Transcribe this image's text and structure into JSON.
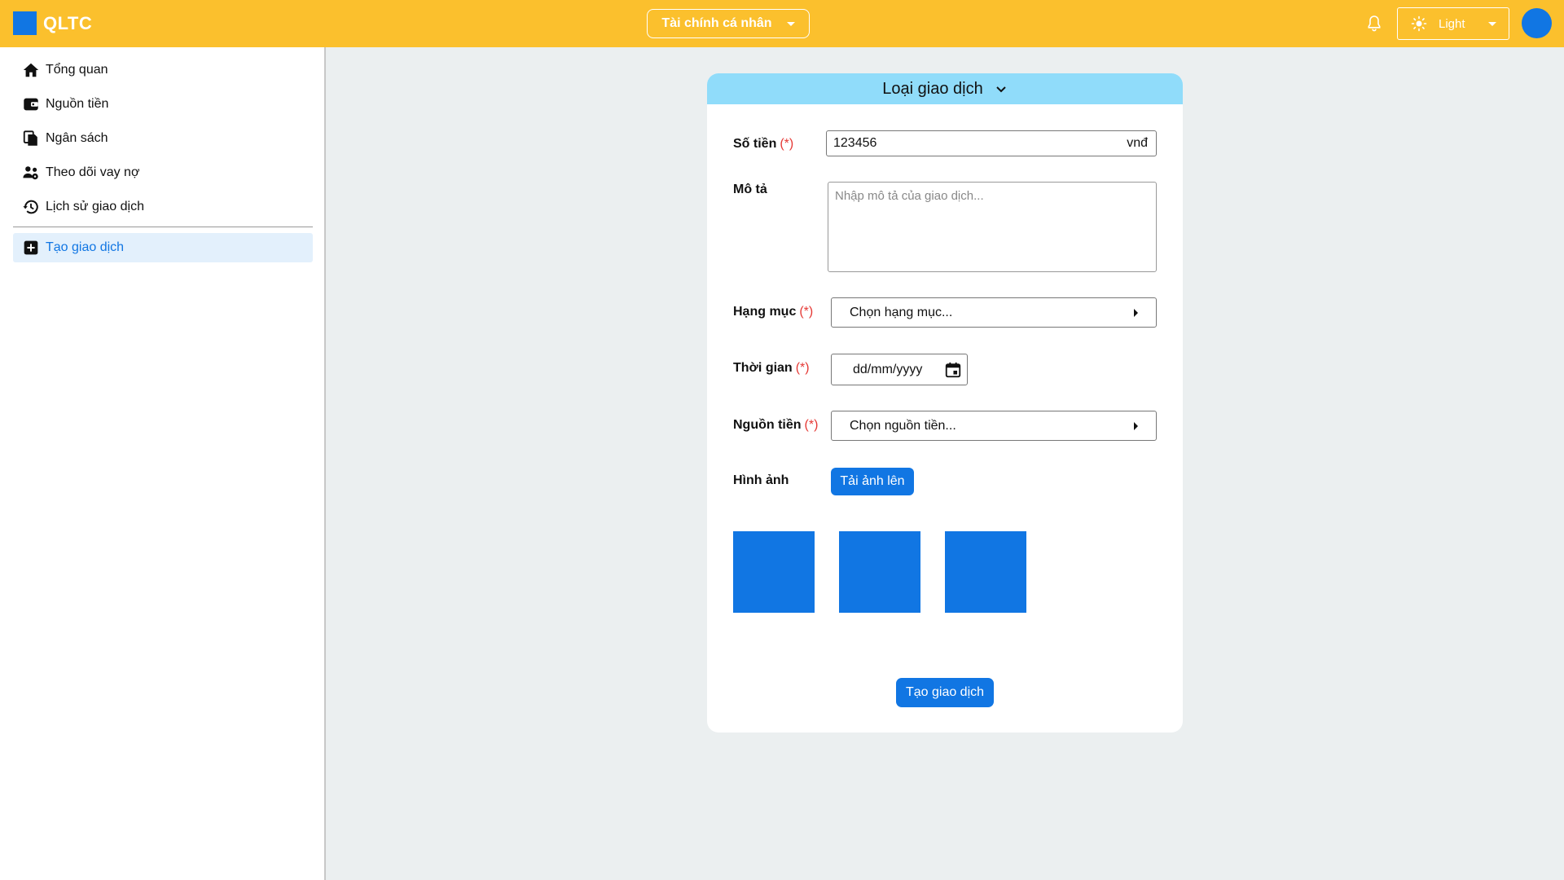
{
  "app": {
    "logo_text": "QLTC"
  },
  "header": {
    "context": "Tài chính cá nhân",
    "theme": "Light"
  },
  "sidebar": {
    "items": [
      {
        "label": "Tổng quan",
        "icon": "home-icon"
      },
      {
        "label": "Nguồn tiền",
        "icon": "wallet-icon"
      },
      {
        "label": "Ngân sách",
        "icon": "budget-icon"
      },
      {
        "label": "Theo dõi vay nợ",
        "icon": "people-icon"
      },
      {
        "label": "Lịch sử giao dịch",
        "icon": "history-icon"
      }
    ],
    "active_item": {
      "label": "Tạo giao dịch",
      "icon": "add-box-icon"
    }
  },
  "form": {
    "title": "Loại giao dịch",
    "required_mark": "(*)",
    "amount": {
      "label": "Số tiền",
      "value": "123456",
      "unit": "vnđ"
    },
    "description": {
      "label": "Mô tả",
      "placeholder": "Nhập mô tả của giao dịch..."
    },
    "category": {
      "label": "Hạng mục",
      "value": "Chọn hạng mục..."
    },
    "time": {
      "label": "Thời gian",
      "value": "dd/mm/yyyy"
    },
    "source": {
      "label": "Nguồn tiền",
      "value": "Chọn nguồn tiền..."
    },
    "image": {
      "label": "Hình ảnh",
      "upload_label": "Tải ảnh lên",
      "thumbnail_count": 3
    },
    "submit_label": "Tạo giao dịch"
  },
  "colors": {
    "header_bg": "#fbc02d",
    "primary": "#1176e3",
    "card_header_bg": "#90dcfa",
    "required": "#e53935",
    "page_bg": "#ebeff0"
  }
}
